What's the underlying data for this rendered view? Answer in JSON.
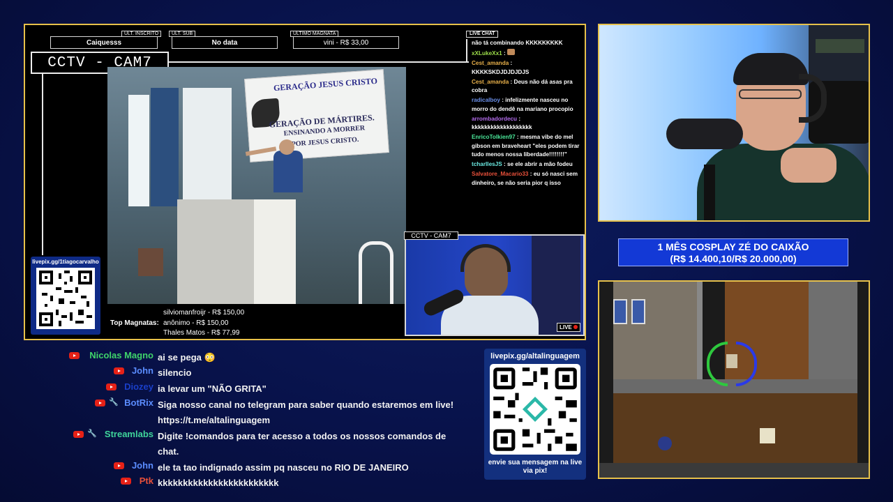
{
  "overlay": {
    "top_boxes": {
      "ult_inscrito_label": "ULT. INSCRITO",
      "ult_inscrito_value": "Caiquesss",
      "ult_sub_label": "ULT. SUB",
      "ult_sub_value": "No data",
      "ultimo_magnata_label": "ULTIMO MAGNATA",
      "ultimo_magnata_value": "vini - R$ 33,00"
    },
    "cctv_main": "CCTV - CAM7",
    "cctv_inset": "CCTV - CAM7",
    "live_badge": "LIVE",
    "livepix_left": "livepix.gg/1tiagocarvalho",
    "video_banner_1": "GERAÇÃO JESUS CRISTO",
    "video_banner_2": "GERAÇÃO DE MÁRTIRES.",
    "video_banner_3": "ENSINANDO A MORRER",
    "video_banner_4": "POR JESUS CRISTO."
  },
  "live_chat": {
    "label": "LIVE CHAT",
    "messages": [
      {
        "user": "",
        "text": "não tá combinando KKKKKKKKK",
        "color": "#ffffff"
      },
      {
        "user": "xXLukeXx1",
        "text": "",
        "color": "#9dde4a"
      },
      {
        "user": "Cest_amanda",
        "text": "KKKKSKDJDJDJDJS",
        "color": "#e8b04a"
      },
      {
        "user": "Cest_amanda",
        "text": "Deus não dá asas pra cobra",
        "color": "#e8b04a"
      },
      {
        "user": "radicalboy",
        "text": "infelizmente nasceu no morro do dendê na mariano procopio",
        "color": "#6a8fe8"
      },
      {
        "user": "arrombadordecu",
        "text": "kkkkkkkkkkkkkkkkkkk",
        "color": "#b06ae8"
      },
      {
        "user": "EnricoTolkien97",
        "text": "mesma vibe do mel gibson em braveheart \"eles podem tirar tudo menos nossa liberdade!!!!!!!!\"",
        "color": "#4ae89a"
      },
      {
        "user": "tcharllesJS",
        "text": "se ele abrir a mão fodeu",
        "color": "#6ae8e0"
      },
      {
        "user": "Salvatore_Macario33",
        "text": "eu só nasci sem dinheiro, se não seria pior q isso",
        "color": "#e8503a"
      }
    ]
  },
  "magnatas": {
    "label": "Top Magnatas:",
    "items": [
      "silviomanfroijr - R$ 150,00",
      "anônimo - R$ 150,00",
      "Thales Matos - R$ 77,99"
    ]
  },
  "goal": {
    "line1": "1 MÊS COSPLAY ZÉ DO CAIXÃO",
    "line2": "(R$ 14.400,10/R$ 20.000,00)",
    "current": 14400.1,
    "target": 20000.0
  },
  "yt_chat": [
    {
      "user": "Nicolas Magno",
      "text": "ai se pega 😳",
      "color": "#3fd46a",
      "wrench": false
    },
    {
      "user": "John",
      "text": "silencio",
      "color": "#5b8dff",
      "wrench": false
    },
    {
      "user": "Diozey",
      "text": "ia levar um \"NÃO GRITA\"",
      "color": "#1a3fc9",
      "wrench": false
    },
    {
      "user": "BotRix",
      "text": "Siga nosso canal no telegram para saber quando estaremos em live!",
      "text2": "https://t.me/altalinguagem",
      "color": "#5b8dff",
      "wrench": true
    },
    {
      "user": "Streamlabs",
      "text": "Digite !comandos para ter acesso a todos os nossos comandos de",
      "text2": "chat.",
      "color": "#3fd49a",
      "wrench": true
    },
    {
      "user": "John",
      "text": "ele ta tao indignado assim pq nasceu no RIO DE JANEIRO",
      "color": "#5b8dff",
      "wrench": false
    },
    {
      "user": "Ptk",
      "text": "kkkkkkkkkkkkkkkkkkkkkkkk",
      "color": "#e8503a",
      "wrench": false
    }
  ],
  "livepix_right": {
    "url": "livepix.gg/altalinguagem",
    "caption": "envie sua mensagem na live via pix!"
  },
  "colors": {
    "frame_gold": "#e7c14a",
    "goal_blue": "#1339d6",
    "youtube_red": "#e62117"
  }
}
